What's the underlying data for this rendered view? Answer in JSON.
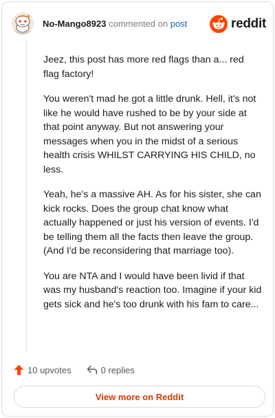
{
  "comment": {
    "username": "No-Mango8923",
    "action_text": "commented on",
    "post_link": "post",
    "paragraphs": [
      "Jeez, this post has more red flags than a... red flag factory!",
      "You weren't mad he got a little drunk. Hell, it's not like he would have rushed to be by your side at that point anyway. But not answering your messages when you in the midst of a serious health crisis WHILST CARRYING HIS CHILD, no less.",
      "Yeah, he's a massive AH. As for his sister, she can kick rocks. Does the group chat know what actually happened or just his version of events. I'd be telling them all the facts then leave the group. (And I'd be reconsidering that marriage too).",
      "You are NTA and I would have been livid if that was my husband's reaction too. Imagine if your kid gets sick and he's too drunk with his fam to care..."
    ],
    "upvotes_label": "10 upvotes",
    "replies_label": "0 replies"
  },
  "brand": {
    "name": "reddit",
    "accent": "#ff4500"
  },
  "footer": {
    "view_more_label": "View more on Reddit",
    "link_color": "#d93a00"
  },
  "icons": {
    "avatar": "snoo-avatar-icon",
    "logo": "reddit-logo-icon",
    "upvote": "upvote-arrow-icon",
    "reply": "reply-arrow-icon"
  }
}
